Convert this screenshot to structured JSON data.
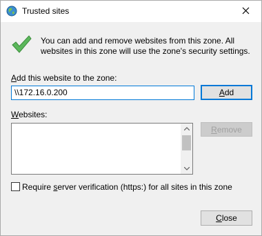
{
  "window": {
    "title": "Trusted sites"
  },
  "info": {
    "text": "You can add and remove websites from this zone. All websites in this zone will use the zone's security settings."
  },
  "add_site": {
    "label_mnemonic": "A",
    "label_rest": "dd this website to the zone:",
    "value": "\\\\172.16.0.200",
    "add_button_mnemonic": "A",
    "add_button_rest": "dd"
  },
  "websites": {
    "label_mnemonic": "W",
    "label_rest": "ebsites:",
    "items": [],
    "remove_button_mnemonic": "R",
    "remove_button_rest": "emove"
  },
  "verification": {
    "checked": false,
    "label_pre": "Require ",
    "label_mnemonic": "s",
    "label_rest": "erver verification (https:) for all sites in this zone"
  },
  "footer": {
    "close_mnemonic": "C",
    "close_rest": "lose"
  },
  "colors": {
    "accent": "#0078d7",
    "check_green": "#4caf50",
    "dialog_bg": "#f0f0f0"
  },
  "icons": {
    "title": "globe-icon",
    "info": "checkmark-icon",
    "close": "close-icon"
  }
}
